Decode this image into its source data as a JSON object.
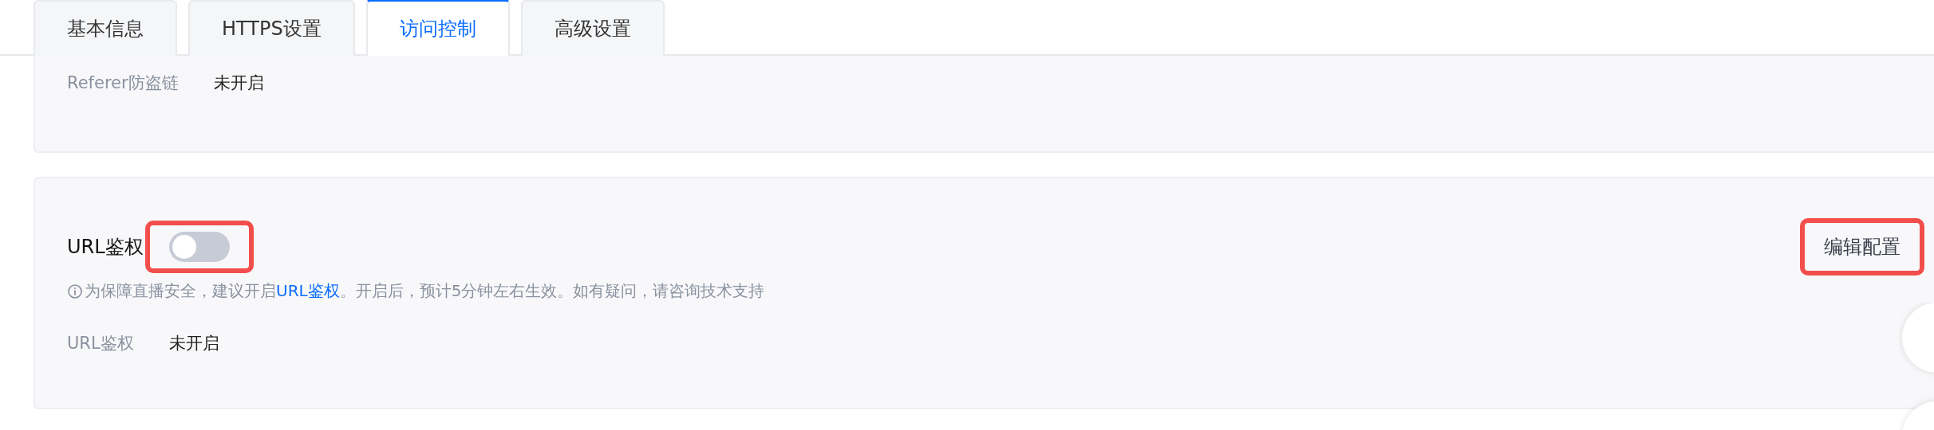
{
  "tabs": [
    {
      "label": "基本信息",
      "selected": false
    },
    {
      "label": "HTTPS设置",
      "selected": false
    },
    {
      "label": "访问控制",
      "selected": true
    },
    {
      "label": "高级设置",
      "selected": false
    }
  ],
  "referer_panel": {
    "label": "Referer防盗链",
    "value": "未开启"
  },
  "url_auth_panel": {
    "title": "URL鉴权",
    "toggle": {
      "on": false,
      "highlighted": true
    },
    "hint": {
      "before": "为保障直播安全，建议开启",
      "link": "URL鉴权",
      "after": "。开启后，预计5分钟左右生效。如有疑问，请咨询技术支持"
    },
    "detail": {
      "label": "URL鉴权",
      "value": "未开启"
    },
    "edit_button": {
      "label": "编辑配置",
      "highlighted": true
    }
  }
}
